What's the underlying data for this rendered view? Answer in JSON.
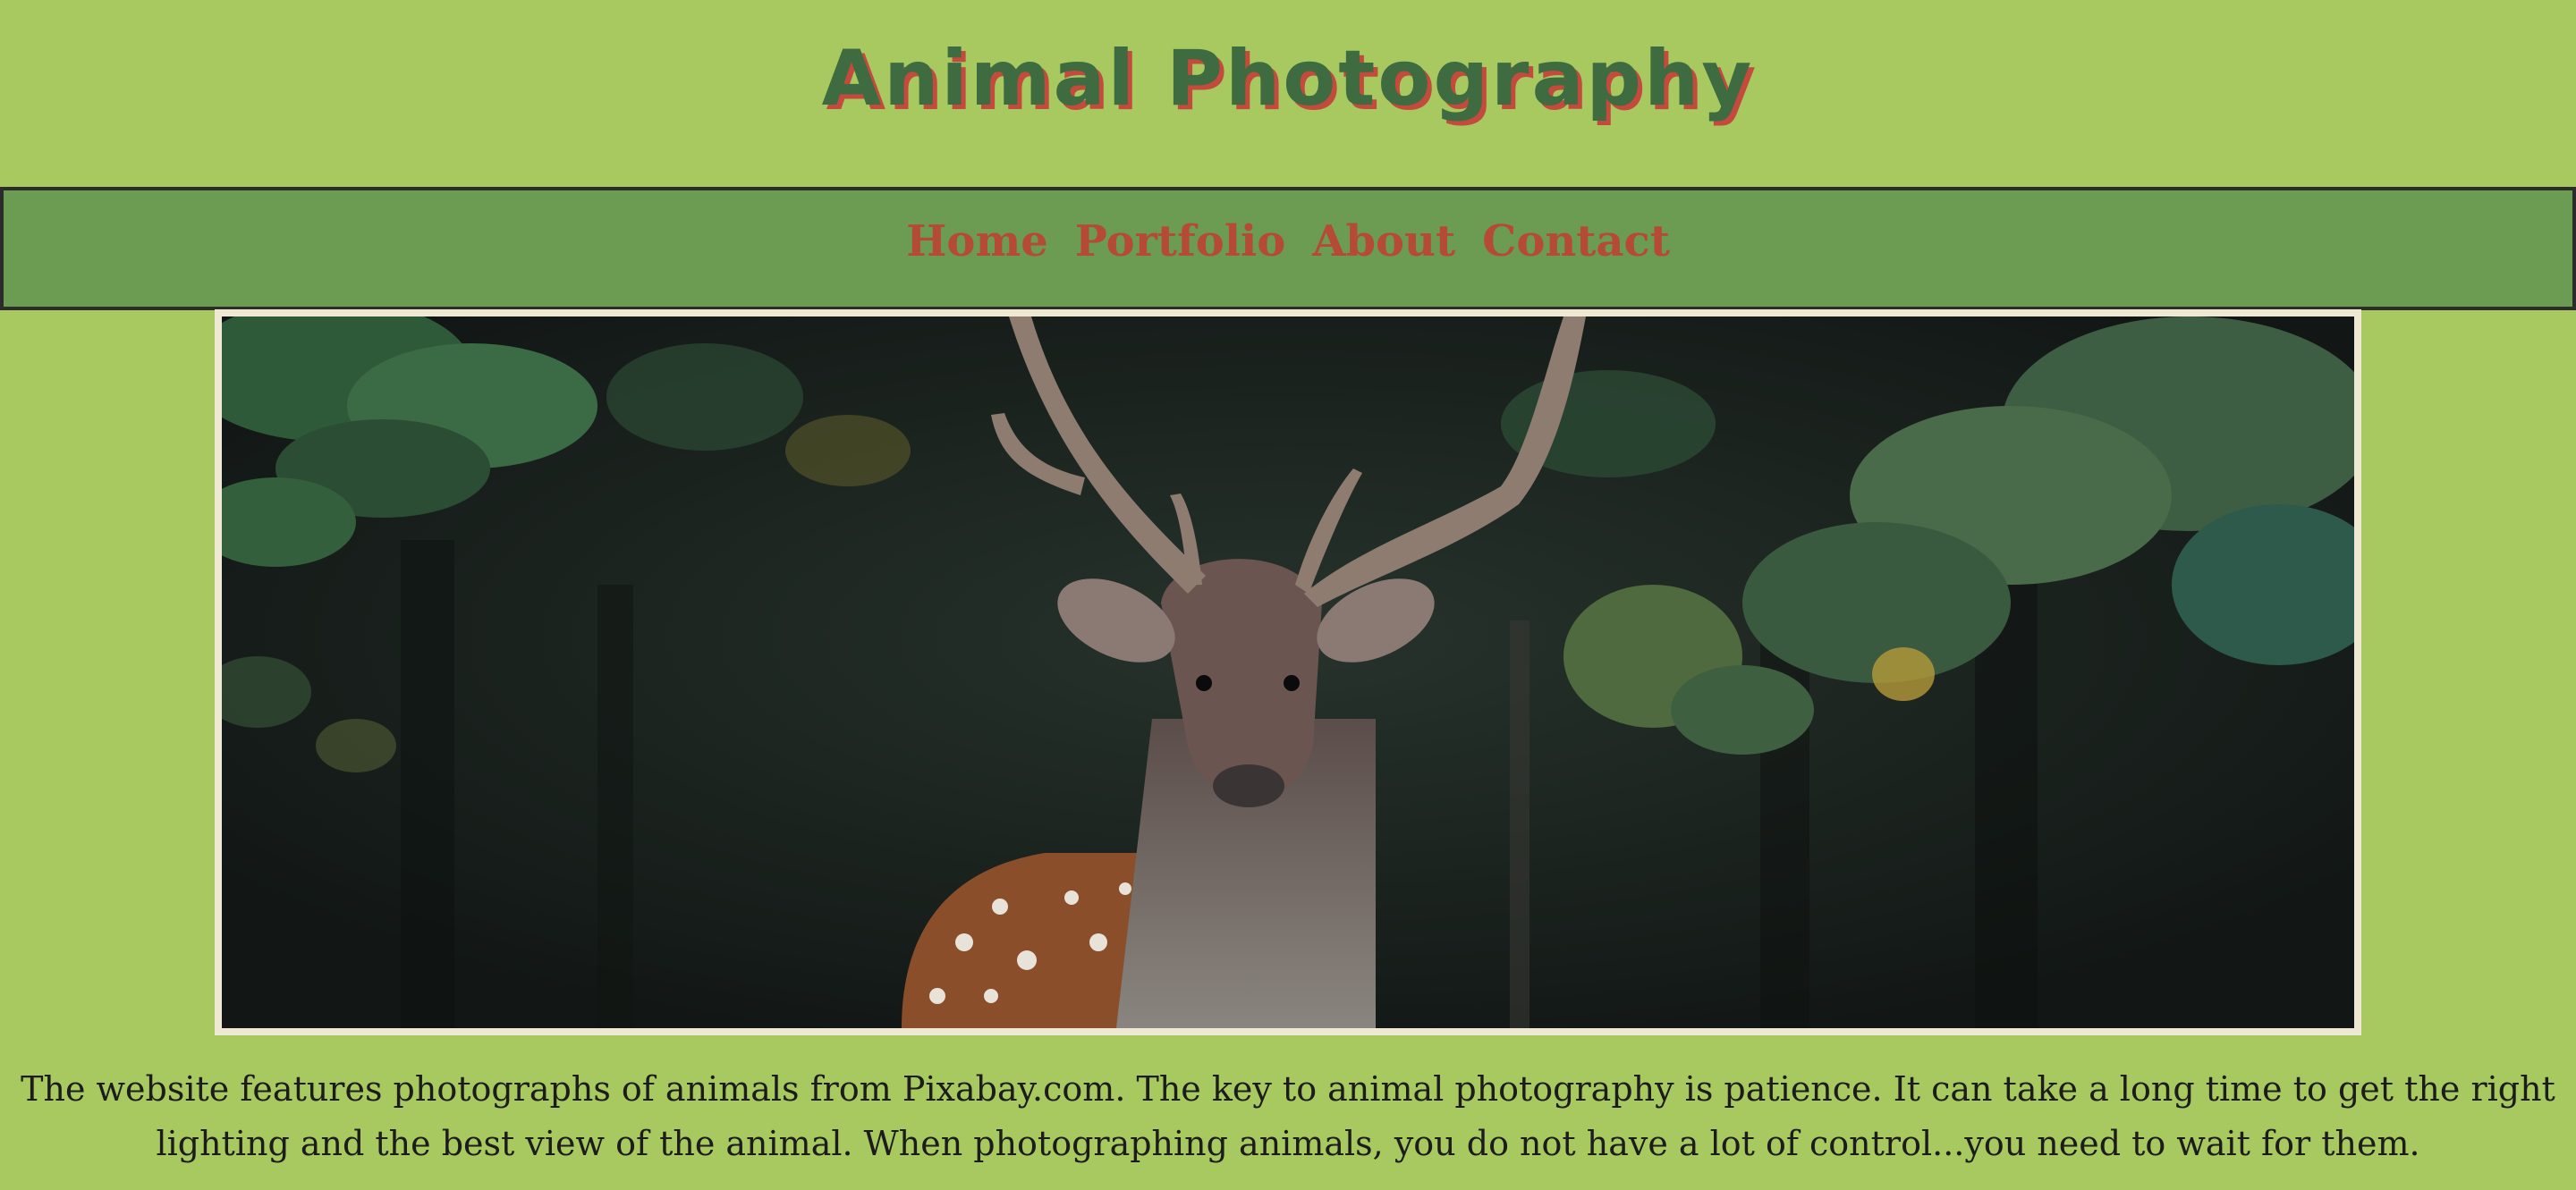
{
  "header": {
    "title": "Animal Photography"
  },
  "nav": {
    "items": [
      {
        "label": "Home"
      },
      {
        "label": "Portfolio"
      },
      {
        "label": "About"
      },
      {
        "label": "Contact"
      }
    ]
  },
  "hero": {
    "subject": "deer-photo"
  },
  "main": {
    "description": "The website features photographs of animals from Pixabay.com. The key to animal photography is patience. It can take a long time to get the right lighting and the best view of the animal. When photographing animals, you do not have a lot of control...you need to wait for them."
  },
  "colors": {
    "page_background": "#a7c95f",
    "title_text": "#3e6b40",
    "title_shadow": "#c44a3e",
    "nav_background": "#6b9c52",
    "nav_border": "#2c2c2c",
    "nav_link": "#b54a36",
    "image_frame": "#efe9d4"
  }
}
